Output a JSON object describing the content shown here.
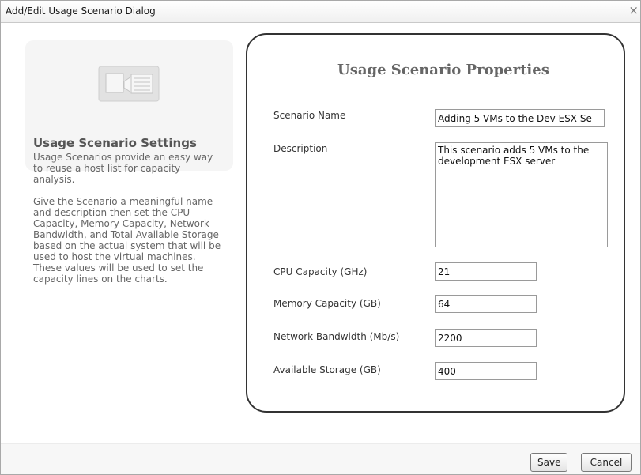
{
  "dialog": {
    "title": "Add/Edit Usage Scenario Dialog",
    "close_glyph": "×"
  },
  "side": {
    "icon": "scenario-settings-icon",
    "heading": "Usage Scenario Settings",
    "paragraph1": "Usage Scenarios provide an easy way to reuse a host list for capacity analysis.",
    "paragraph2": "Give the Scenario a meaningful name and description then set the CPU Capacity, Memory Capacity, Network Bandwidth, and Total Available Storage based on the actual system that will be used to host the virtual machines. These values will be used to set the capacity lines on the charts."
  },
  "props": {
    "heading": "Usage Scenario Properties",
    "scenario_name": {
      "label": "Scenario Name",
      "value": "Adding 5 VMs to the Dev ESX Se"
    },
    "description": {
      "label": "Description",
      "value": "This scenario adds 5 VMs to the development ESX server"
    },
    "cpu": {
      "label": "CPU Capacity (GHz)",
      "value": "21"
    },
    "memory": {
      "label": "Memory Capacity (GB)",
      "value": "64"
    },
    "network": {
      "label": "Network Bandwidth (Mb/s)",
      "value": "2200"
    },
    "storage": {
      "label": "Available Storage (GB)",
      "value": "400"
    }
  },
  "footer": {
    "save_label": "Save",
    "cancel_label": "Cancel"
  }
}
